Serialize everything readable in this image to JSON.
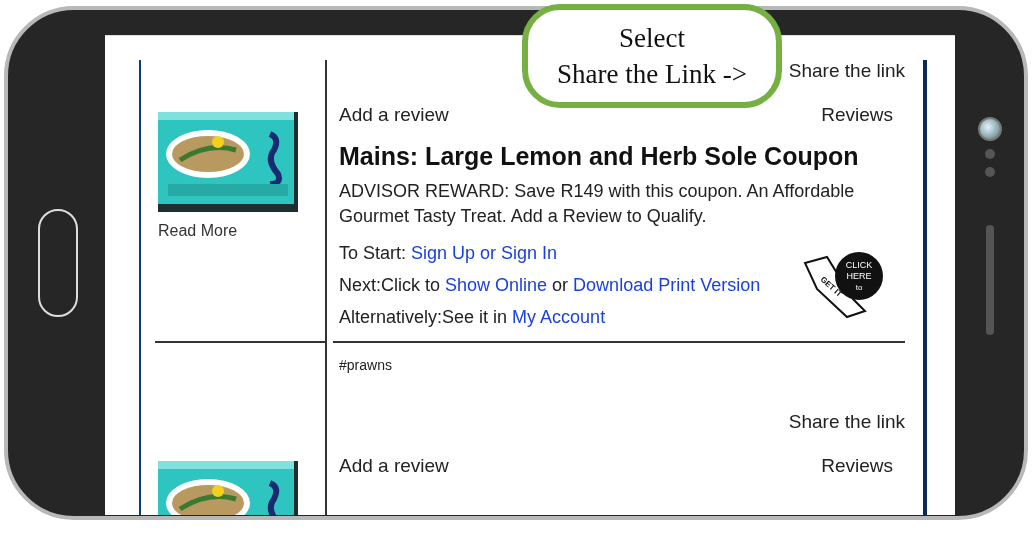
{
  "callout": {
    "lines": [
      "Select",
      "Share the Link ->"
    ]
  },
  "listings": [
    {
      "share_link": "Share the link",
      "add_review": "Add a review",
      "reviews": "Reviews",
      "title": "Mains: Large Lemon and Herb Sole Coupon",
      "description": "ADVISOR REWARD: Save R149 with this coupon. An Affordable Gourmet Tasty Treat. Add a Review to Qualify.",
      "steps": [
        [
          {
            "kind": "text",
            "text": "To Start: "
          },
          {
            "kind": "link",
            "text": "Sign Up or Sign In"
          }
        ],
        [
          {
            "kind": "text",
            "text": "Next:Click to "
          },
          {
            "kind": "link",
            "text": "Show Online"
          },
          {
            "kind": "text",
            "text": " or "
          },
          {
            "kind": "link",
            "text": "Download Print Version"
          }
        ],
        [
          {
            "kind": "text",
            "text": "Alternatively:See it in "
          },
          {
            "kind": "link",
            "text": "My Account"
          }
        ]
      ],
      "badge": {
        "lines": [
          "CLICK",
          "HERE",
          "to"
        ],
        "hand_text": "GET IT"
      },
      "read_more": "Read More"
    },
    {
      "tag": "#prawns",
      "share_link": "Share the link",
      "add_review": "Add a review",
      "reviews": "Reviews"
    }
  ]
}
